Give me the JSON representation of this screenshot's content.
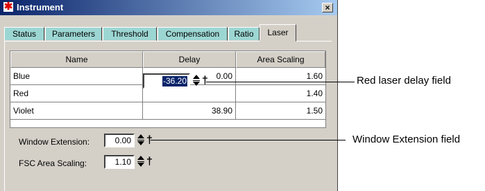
{
  "window": {
    "title": "Instrument",
    "close_label": "×"
  },
  "tabs": [
    {
      "label": "Status",
      "active": false
    },
    {
      "label": "Parameters",
      "active": false
    },
    {
      "label": "Threshold",
      "active": false
    },
    {
      "label": "Compensation",
      "active": false
    },
    {
      "label": "Ratio",
      "active": false
    },
    {
      "label": "Laser",
      "active": true
    }
  ],
  "table": {
    "headers": [
      "Name",
      "Delay",
      "Area Scaling"
    ],
    "rows": [
      {
        "name": "Blue",
        "delay": "0.00",
        "area_scaling": "1.60"
      },
      {
        "name": "Red",
        "delay": "-36.20",
        "area_scaling": "1.40"
      },
      {
        "name": "Violet",
        "delay": "38.90",
        "area_scaling": "1.50"
      }
    ]
  },
  "settings": {
    "window_extension_label": "Window Extension:",
    "window_extension_value": "0.00",
    "fsc_area_scaling_label": "FSC Area Scaling:",
    "fsc_area_scaling_value": "1.10"
  },
  "callouts": {
    "red_delay": "Red laser delay field",
    "window_extension": "Window Extension field"
  },
  "icons": {
    "title": "asterisk-app-icon",
    "spin": "spin-arrows-icon",
    "lock": "dagger-icon"
  },
  "colors": {
    "titlebar_start": "#0a246a",
    "titlebar_end": "#a6caf0",
    "inactive_tab": "#9cd6d2",
    "selection": "#0a246a",
    "window_bg": "#d4d0c8"
  }
}
